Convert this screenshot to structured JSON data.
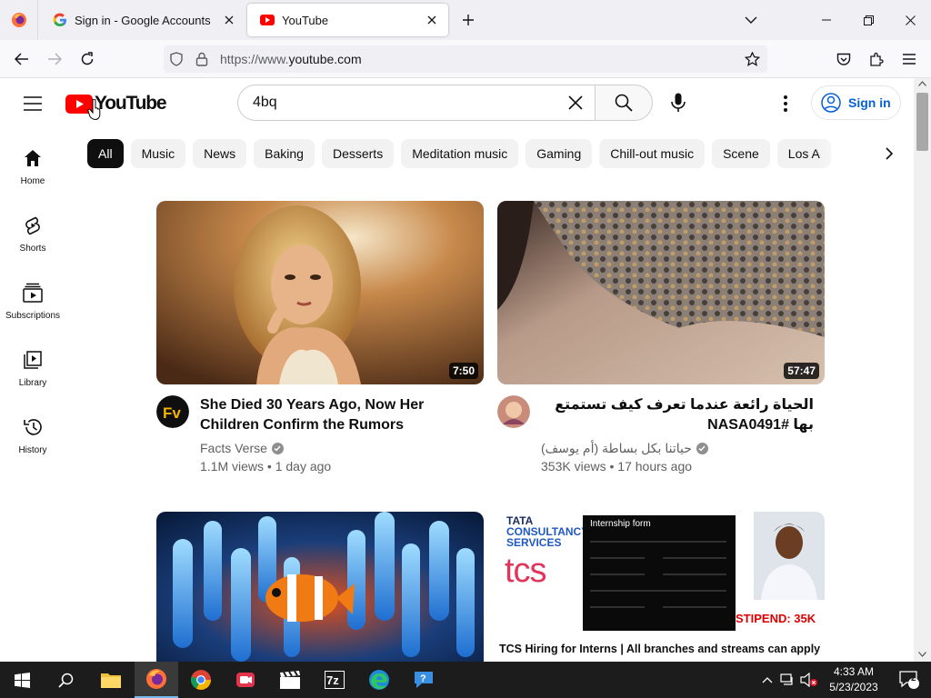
{
  "browser": {
    "tabs": [
      {
        "title": "Sign in - Google Accounts",
        "active": false
      },
      {
        "title": "YouTube",
        "active": true
      }
    ],
    "address": {
      "prefix": "https://www.",
      "host": "youtube.com"
    }
  },
  "youtube": {
    "logo_text": "YouTube",
    "search_query": "4bq",
    "sign_in_label": "Sign in",
    "chips": [
      "All",
      "Music",
      "News",
      "Baking",
      "Desserts",
      "Meditation music",
      "Gaming",
      "Chill-out music",
      "Scene",
      "Los A"
    ],
    "guide": [
      {
        "label": "Home",
        "icon": "home-icon"
      },
      {
        "label": "Shorts",
        "icon": "shorts-icon"
      },
      {
        "label": "Subscriptions",
        "icon": "subscriptions-icon"
      },
      {
        "label": "Library",
        "icon": "library-icon"
      },
      {
        "label": "History",
        "icon": "history-icon"
      }
    ],
    "videos": [
      {
        "title": "She Died 30 Years Ago, Now Her Children Confirm the Rumors",
        "channel": "Facts Verse",
        "views": "1.1M views",
        "age": "1 day ago",
        "duration": "7:50",
        "avatar_text": "Fv"
      },
      {
        "title": "الحياة رائعة عندما تعرف كيف تستمتع بها #NASA0491",
        "channel": "حياتنا بكل بساطة (أم يوسف)",
        "views": "353K views",
        "age": "17 hours ago",
        "duration": "57:47"
      },
      {
        "title": "",
        "channel": "",
        "views": "",
        "age": "",
        "duration": ""
      },
      {
        "title": "",
        "channel": "",
        "views": "",
        "age": "",
        "duration": "",
        "thumb_text": {
          "brand_line1": "TATA",
          "brand_line2": "CONSULTANCY",
          "brand_line3": "SERVICES",
          "brand_logo": "tcs",
          "form_title": "Internship form",
          "stipend": "STIPEND: 35K",
          "caption": "TCS Hiring for Interns | All branches and streams can apply"
        }
      }
    ]
  },
  "taskbar": {
    "time": "4:33 AM",
    "date": "5/23/2023",
    "notifications": "2"
  },
  "colors": {
    "yt_red": "#ff0000",
    "link_blue": "#065fd4",
    "chip_bg": "#f2f2f2",
    "taskbar": "#1c1c1c"
  }
}
